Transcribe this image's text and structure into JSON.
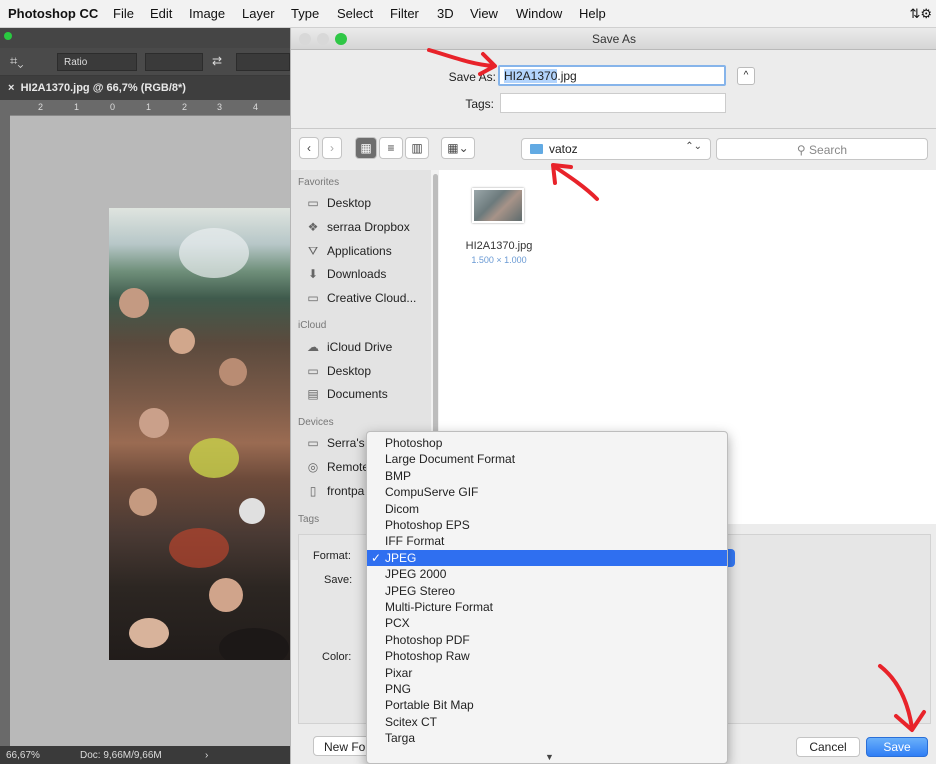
{
  "menubar": {
    "app": "Photoshop CC",
    "items": [
      "File",
      "Edit",
      "Image",
      "Layer",
      "Type",
      "Select",
      "Filter",
      "3D",
      "View",
      "Window",
      "Help"
    ],
    "status_icon": "dropbox-sync-icon"
  },
  "photoshop": {
    "options_ratio": "Ratio",
    "doc_tab": "HI2A1370.jpg @ 66,7% (RGB/8*)",
    "ruler_ticks": [
      "2",
      "1",
      "0",
      "1",
      "2",
      "3",
      "4"
    ],
    "status_zoom": "66,67%",
    "status_doc": "Doc: 9,66M/9,66M"
  },
  "dialog": {
    "title": "Save As",
    "save_as_label": "Save As:",
    "filename_selected": "HI2A1370",
    "filename_ext": ".jpg",
    "tags_label": "Tags:",
    "expand_glyph": "^",
    "folder": "vatoz",
    "search_placeholder": "Search",
    "sidebar": {
      "favorites_header": "Favorites",
      "favorites": [
        {
          "label": "Desktop",
          "icon": "desktop-icon"
        },
        {
          "label": "serraa Dropbox",
          "icon": "dropbox-icon"
        },
        {
          "label": "Applications",
          "icon": "applications-icon"
        },
        {
          "label": "Downloads",
          "icon": "downloads-icon"
        },
        {
          "label": "Creative Cloud...",
          "icon": "folder-icon"
        }
      ],
      "icloud_header": "iCloud",
      "icloud": [
        {
          "label": "iCloud Drive",
          "icon": "cloud-icon"
        },
        {
          "label": "Desktop",
          "icon": "desktop-icon"
        },
        {
          "label": "Documents",
          "icon": "documents-icon"
        }
      ],
      "devices_header": "Devices",
      "devices": [
        {
          "label": "Serra's",
          "icon": "computer-icon"
        },
        {
          "label": "Remote",
          "icon": "disc-icon"
        },
        {
          "label": "frontpa",
          "icon": "drive-icon"
        }
      ],
      "tags_header": "Tags"
    },
    "file": {
      "name": "HI2A1370.jpg",
      "dims": "1.500 × 1.000"
    },
    "options": {
      "format_label": "Format:",
      "save_label": "Save:",
      "color_label": "Color:"
    },
    "new_folder": "New Folder",
    "cancel": "Cancel",
    "save": "Save"
  },
  "format_menu": {
    "selected": "JPEG",
    "items": [
      "Photoshop",
      "Large Document Format",
      "BMP",
      "CompuServe GIF",
      "Dicom",
      "Photoshop EPS",
      "IFF Format",
      "JPEG",
      "JPEG 2000",
      "JPEG Stereo",
      "Multi-Picture Format",
      "PCX",
      "Photoshop PDF",
      "Photoshop Raw",
      "Pixar",
      "PNG",
      "Portable Bit Map",
      "Scitex CT",
      "Targa"
    ],
    "check_glyph": "✓",
    "more_glyph": "▼"
  },
  "colors": {
    "accent": "#2f6ff0",
    "annotation": "#e8232a"
  }
}
